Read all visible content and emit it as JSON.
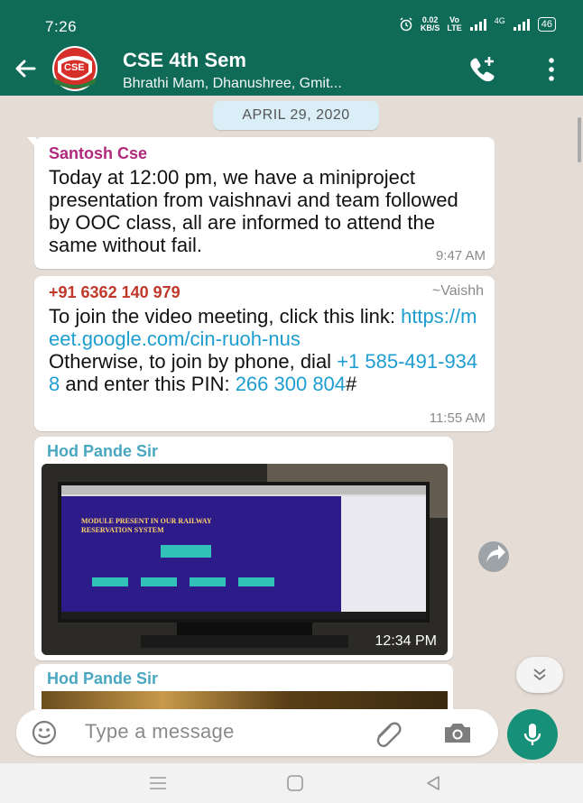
{
  "status_bar": {
    "time": "7:26",
    "net_speed_value": "0.02",
    "net_speed_unit": "KB/S",
    "network_a": "Vo",
    "network_b": "LTE",
    "signal_label": "4G",
    "battery": "46"
  },
  "header": {
    "avatar_text": "CSE",
    "title": "CSE 4th Sem",
    "subtitle": "Bhrathi Mam, Dhanushree, Gmit..."
  },
  "chat": {
    "date": "APRIL 29, 2020",
    "messages": [
      {
        "sender": "Santosh Cse",
        "text": "Today at 12:00 pm, we have a miniproject presentation from vaishnavi and team followed by OOC class, all are informed to attend the same without fail.",
        "time": "9:47 AM"
      },
      {
        "sender": "+91 6362 140 979",
        "pushname": "~Vaishh",
        "text_1": "To join the video meeting, click this link: ",
        "link": "https://meet.google.com/cin-ruoh-nus",
        "text_2": "Otherwise, to join by phone, dial ",
        "phone": "+1 585-491-9348",
        "text_3": " and enter this PIN: ",
        "pin": "266 300 804",
        "text_4": "#",
        "time": "11:55 AM"
      },
      {
        "sender": "Hod Pande Sir",
        "photo_caption_line1": "MODULE PRESENT IN OUR RAILWAY",
        "photo_caption_line2": "RESERVATION SYSTEM",
        "time": "12:34 PM"
      },
      {
        "sender": "Hod Pande Sir"
      }
    ]
  },
  "composer": {
    "placeholder": "Type a message"
  },
  "colors": {
    "header_bg": "#0f6a57",
    "chat_bg": "#e5ddd5",
    "mic_bg": "#17907a",
    "link": "#1e9ed0"
  }
}
